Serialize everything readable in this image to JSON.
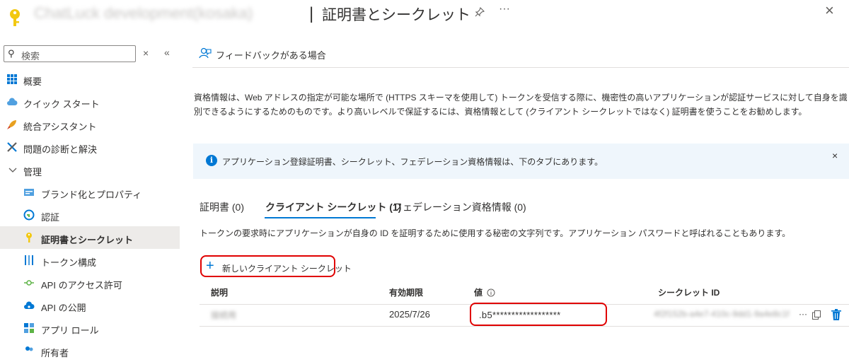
{
  "header": {
    "app_name": "ChatLuck development(kosaka)",
    "separator": "|",
    "title": "証明書とシークレット",
    "pin_icon": "pin-icon",
    "more": "···",
    "close": "×"
  },
  "search": {
    "placeholder": "検索",
    "clear": "×",
    "collapse": "«"
  },
  "sidebar": {
    "items": [
      {
        "label": "概要",
        "icon": "grid-icon"
      },
      {
        "label": "クイック スタート",
        "icon": "cloud-icon"
      },
      {
        "label": "統合アシスタント",
        "icon": "rocket-icon"
      },
      {
        "label": "問題の診断と解決",
        "icon": "wrench-icon"
      },
      {
        "label": "管理",
        "icon": "chevron-down-icon"
      },
      {
        "label": "ブランド化とプロパティ",
        "icon": "card-icon"
      },
      {
        "label": "認証",
        "icon": "auth-icon"
      },
      {
        "label": "証明書とシークレット",
        "icon": "key-icon"
      },
      {
        "label": "トークン構成",
        "icon": "bars-icon"
      },
      {
        "label": "API のアクセス許可",
        "icon": "api-permission-icon"
      },
      {
        "label": "API の公開",
        "icon": "cloud-api-icon"
      },
      {
        "label": "アプリ ロール",
        "icon": "app-roles-icon"
      },
      {
        "label": "所有者",
        "icon": "owners-icon"
      }
    ]
  },
  "toolbar": {
    "feedback": "フィードバックがある場合"
  },
  "main": {
    "description": "資格情報は、Web アドレスの指定が可能な場所で (HTTPS スキーマを使用して) トークンを受信する際に、機密性の高いアプリケーションが認証サービスに対して自身を識別できるようにするためのものです。より高いレベルで保証するには、資格情報として (クライアント シークレットではなく) 証明書を使うことをお勧めします。",
    "info": "アプリケーション登録証明書、シークレット、フェデレーション資格情報は、下のタブにあります。",
    "info_close": "×",
    "tabs": [
      {
        "label": "証明書 (0)"
      },
      {
        "label": "クライアント シークレット (1)"
      },
      {
        "label": "フェデレーション資格情報 (0)"
      }
    ],
    "tab_description": "トークンの要求時にアプリケーションが自身の ID を証明するために使用する秘密の文字列です。アプリケーション パスワードと呼ばれることもあります。",
    "new_secret": "新しいクライアント シークレット",
    "table": {
      "columns": [
        "説明",
        "有効期限",
        "値",
        "シークレット ID"
      ],
      "rows": [
        {
          "description": "接続用",
          "expires": "2025/7/26",
          "value": ".b5******************",
          "secret_id": "4f2f152b-a4e7-410c-9dd1-9a4e8c1f"
        }
      ],
      "more": "···"
    }
  },
  "colors": {
    "accent": "#0078d4",
    "highlight": "#e00000",
    "info_bg": "#eff6fc"
  }
}
